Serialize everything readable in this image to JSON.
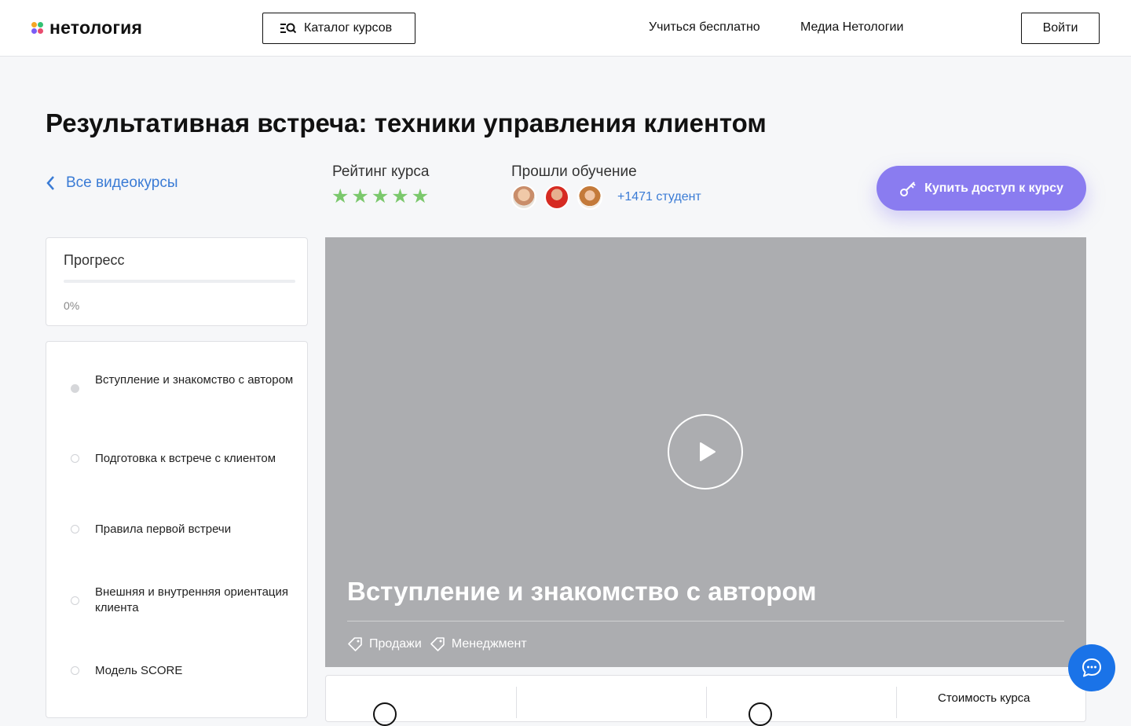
{
  "header": {
    "logo_text": "нетология",
    "catalog_label": "Каталог курсов",
    "nav": [
      "Учиться бесплатно",
      "Медиа Нетологии"
    ],
    "login_label": "Войти"
  },
  "course": {
    "title": "Результативная встреча: техники управления клиентом",
    "back_label": "Все видеокурсы",
    "rating_label": "Рейтинг курса",
    "rating_stars": 5,
    "passed_label": "Прошли обучение",
    "students_label": "+1471 студент",
    "buy_label": "Купить доступ к курсу"
  },
  "progress": {
    "title": "Прогресс",
    "value_label": "0%",
    "fraction": 0
  },
  "lessons": [
    {
      "label": "Вступление и знакомство с автором",
      "active": true
    },
    {
      "label": "Подготовка к встрече с клиентом",
      "active": false
    },
    {
      "label": "Правила первой встречи",
      "active": false
    },
    {
      "label": "Внешняя и внутренняя ориентация клиента",
      "active": false
    },
    {
      "label": "Модель SCORE",
      "active": false
    }
  ],
  "video": {
    "title": "Вступление и знакомство с автором",
    "tags": [
      "Продажи",
      "Менеджмент"
    ]
  },
  "info": {
    "cost_label": "Стоимость курса"
  },
  "colors": {
    "accent_purple": "#8a7cf0",
    "link_blue": "#3a7bd5",
    "star_green": "#7bc86c",
    "chat_blue": "#1a73e8"
  }
}
